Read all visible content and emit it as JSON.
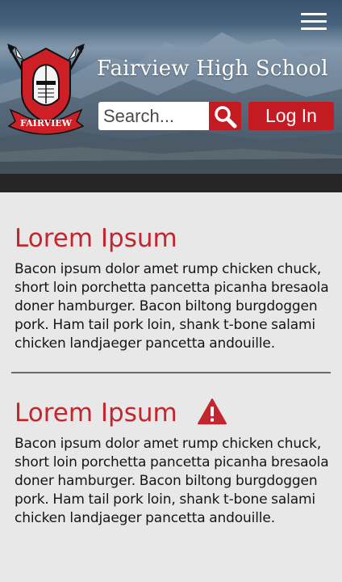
{
  "header": {
    "school_name": "Fairview High School",
    "logo_text": "FAIRVIEW",
    "menu_icon": "hamburger-menu-icon",
    "search": {
      "placeholder": "Search...",
      "button_icon": "magnifying-glass-icon"
    },
    "login_label": "Log In"
  },
  "articles": [
    {
      "title": "Lorem Ipsum",
      "body": "Bacon ipsum dolor amet rump chicken chuck, short loin porchetta pancetta picanha bresaola doner hamburger. Bacon biltong burgdoggen pork. Ham tail pork loin, shank t-bone salami chicken landjaeger pancetta andouille."
    },
    {
      "title": "Lorem Ipsum",
      "icon": "warning-icon",
      "body": "Bacon ipsum dolor amet rump chicken chuck, short loin porchetta pancetta picanha bresaola doner hamburger. Bacon biltong burgdoggen pork. Ham tail pork loin, shank t-bone salami chicken landjaeger pancetta andouille."
    }
  ],
  "colors": {
    "accent_red": "#c41b22",
    "title_red": "#c3262e",
    "dark_bar": "#262626",
    "page_background": "#e8e8e8",
    "divider": "#6a6a6a"
  }
}
